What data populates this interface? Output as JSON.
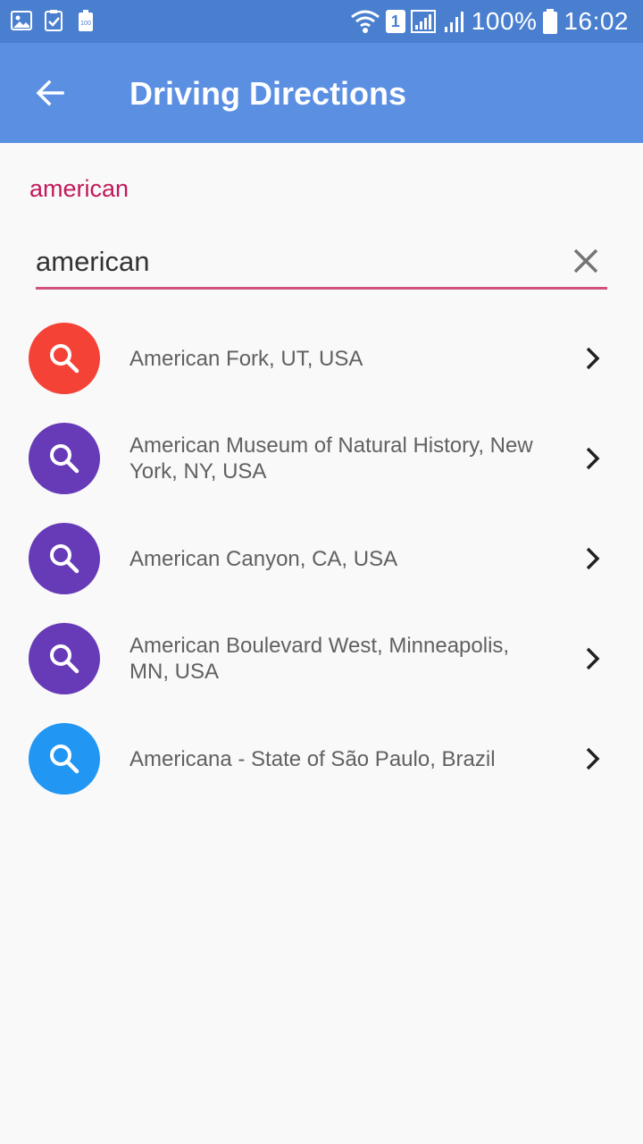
{
  "status_bar": {
    "battery_percent": "100%",
    "time": "16:02",
    "sim_slot": "1",
    "left_icons": [
      "image-icon",
      "clipboard-check-icon",
      "battery-saver-icon"
    ],
    "right_icons": [
      "wifi-icon",
      "sim-icon",
      "signal-icon",
      "signal-icon",
      "battery-icon"
    ]
  },
  "app_bar": {
    "title": "Driving Directions",
    "back_icon": "arrow-left-icon",
    "background": "#5a8fe2"
  },
  "query_label": "american",
  "search": {
    "value": "american",
    "clear_icon": "close-icon",
    "underline_color": "#d05080"
  },
  "results": [
    {
      "label": "American Fork, UT, USA",
      "icon": "search-icon",
      "color": "#f44336"
    },
    {
      "label": "American Museum of Natural History, New York, NY, USA",
      "icon": "search-icon",
      "color": "#673ab7"
    },
    {
      "label": "American Canyon, CA, USA",
      "icon": "search-icon",
      "color": "#673ab7"
    },
    {
      "label": "American Boulevard West, Minneapolis, MN, USA",
      "icon": "search-icon",
      "color": "#673ab7"
    },
    {
      "label": "Americana - State of São Paulo, Brazil",
      "icon": "search-icon",
      "color": "#2196f3"
    }
  ]
}
